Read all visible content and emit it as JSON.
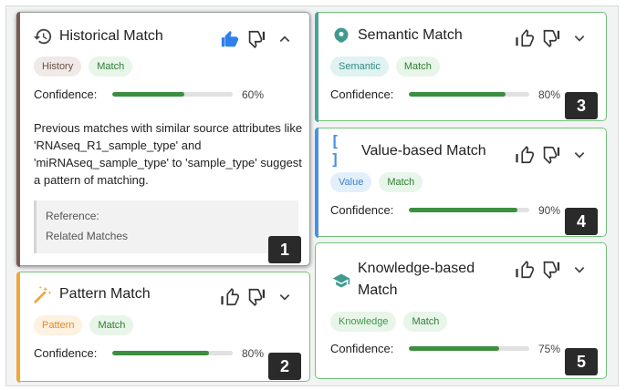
{
  "confidence_label": "Confidence:",
  "colors": {
    "history_accent": "#7a5a52",
    "pattern_accent": "#f0a63a",
    "semantic_accent": "#4aa39a",
    "value_accent": "#4a90e2",
    "knowledge_accent": "#73c27a",
    "bar_fill": "#3c8f3f",
    "thumb_active": "#2f80ed"
  },
  "cards": {
    "historical": {
      "title": "Historical Match",
      "icon": "history-icon",
      "chips": [
        "History",
        "Match"
      ],
      "confidence": 0.6,
      "confidence_text": "60%",
      "description": "Previous matches with similar source attributes like 'RNAseq_R1_sample_type' and 'miRNAseq_sample_type' to 'sample_type' suggest a pattern of matching.",
      "reference_label": "Reference:",
      "reference_value": "Related Matches",
      "thumbs_up_active": true,
      "expanded": true,
      "badge": "1"
    },
    "pattern": {
      "title": "Pattern Match",
      "icon": "magic-wand-icon",
      "chips": [
        "Pattern",
        "Match"
      ],
      "confidence": 0.8,
      "confidence_text": "80%",
      "badge": "2"
    },
    "semantic": {
      "title": "Semantic Match",
      "icon": "brain-icon",
      "chips": [
        "Semantic",
        "Match"
      ],
      "confidence": 0.8,
      "confidence_text": "80%",
      "badge": "3"
    },
    "value": {
      "title": "Value-based Match",
      "icon": "brackets-icon",
      "chips": [
        "Value",
        "Match"
      ],
      "confidence": 0.9,
      "confidence_text": "90%",
      "badge": "4"
    },
    "knowledge": {
      "title": "Knowledge-based Match",
      "icon": "graduation-cap-icon",
      "chips": [
        "Knowledge",
        "Match"
      ],
      "confidence": 0.75,
      "confidence_text": "75%",
      "badge": "5"
    }
  }
}
